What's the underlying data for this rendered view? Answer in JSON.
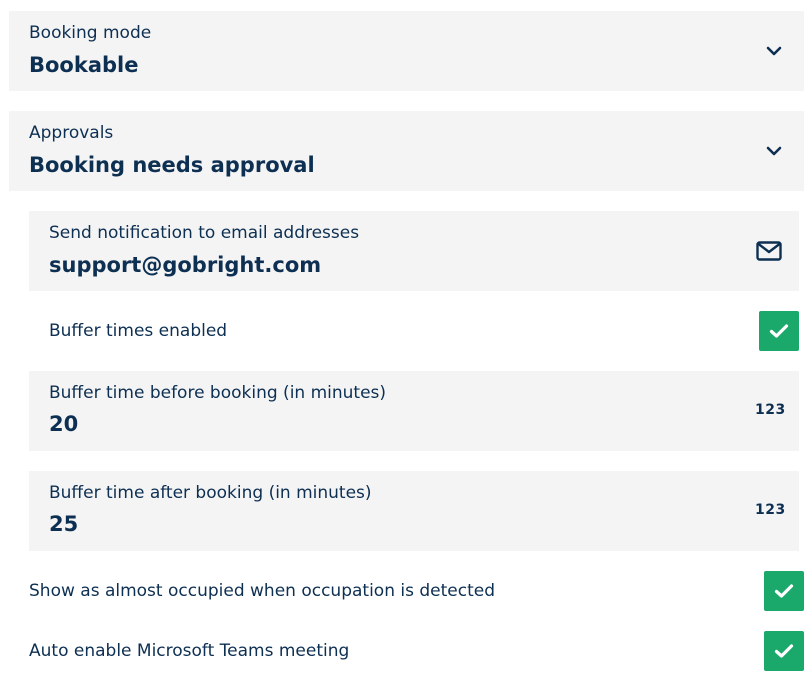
{
  "booking_mode": {
    "label": "Booking mode",
    "value": "Bookable",
    "icon": "chevron-down-icon"
  },
  "approvals": {
    "label": "Approvals",
    "value": "Booking needs approval",
    "icon": "chevron-down-icon"
  },
  "notification": {
    "label": "Send notification to email addresses",
    "value": "support@gobright.com",
    "icon": "envelope-icon"
  },
  "buffer_enabled": {
    "label": "Buffer times enabled",
    "checked": true
  },
  "buffer_before": {
    "label": "Buffer time before booking (in minutes)",
    "value": "20",
    "icon_text": "123"
  },
  "buffer_after": {
    "label": "Buffer time after booking (in minutes)",
    "value": "25",
    "icon_text": "123"
  },
  "almost_occupied": {
    "label": "Show as almost occupied when occupation is detected",
    "checked": true
  },
  "teams_meeting": {
    "label": "Auto enable Microsoft Teams meeting",
    "checked": true
  },
  "colors": {
    "text": "#0d2f52",
    "field_bg": "#f4f4f4",
    "check_green": "#1ba86b"
  }
}
